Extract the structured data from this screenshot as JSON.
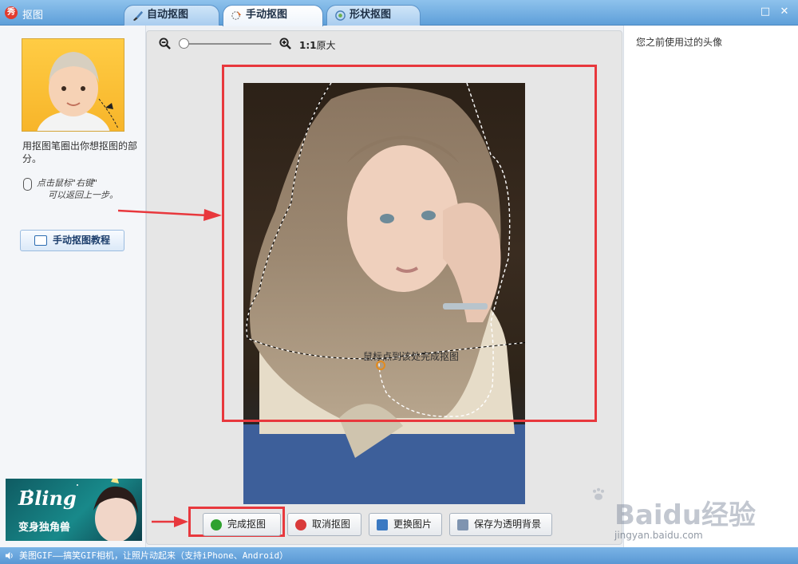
{
  "window": {
    "logo": "秀",
    "title": "抠图",
    "tabs": [
      {
        "label": "自动抠图"
      },
      {
        "label": "手动抠图"
      },
      {
        "label": "形状抠图"
      }
    ],
    "maximize": "□",
    "close": "✕"
  },
  "left_panel": {
    "instruction": "用抠图笔圈出你想抠图的部分。",
    "right_click_hint_line1": "点击鼠标\"右键\"",
    "right_click_hint_line2": "可以返回上一步。",
    "tutorial_button": "手动抠图教程",
    "ad": {
      "title": "Bling",
      "subtitle": "变身独角兽"
    }
  },
  "toolbar": {
    "zoom_ratio": "1:1",
    "zoom_label": "原大",
    "zoom_level": 0.05
  },
  "canvas": {
    "overlay_hint": "鼠标点到该处完成抠图"
  },
  "buttons": {
    "finish": "完成抠图",
    "cancel": "取消抠图",
    "replace": "更换图片",
    "save_transparent": "保存为透明背景"
  },
  "right_panel": {
    "title": "您之前使用过的头像"
  },
  "watermark": {
    "brand": "Baidu经验",
    "url": "jingyan.baidu.com"
  },
  "status_bar": {
    "text": "美图GIF——搞笑GIF相机，让照片动起来（支持iPhone、Android）"
  },
  "colors": {
    "highlight_red": "#e8383d",
    "title_blue": "#5e9fd9",
    "finish_icon_green": "#2fa12f",
    "cancel_icon_red": "#d93a3a"
  }
}
